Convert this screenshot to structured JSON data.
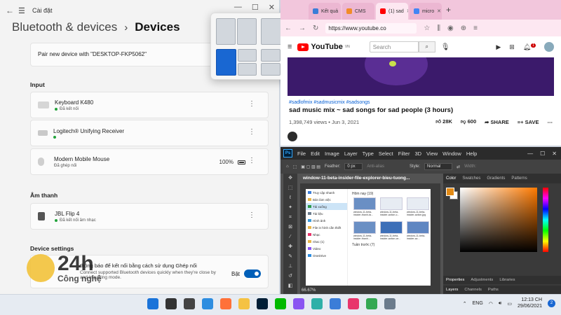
{
  "settings": {
    "app_title": "Cài đặt",
    "breadcrumb": "Bluetooth & devices",
    "page_title": "Devices",
    "pair_text": "Pair new device with \"DESKTOP-FKP5062\"",
    "input_label": "Input",
    "devices_input": [
      {
        "name": "Keyboard K480",
        "status": "Đã kết nối",
        "connected": true
      },
      {
        "name": "Logitech® Unifying Receiver",
        "status": "",
        "connected": true
      },
      {
        "name": "Modern Mobile Mouse",
        "status": "Đã ghép nối",
        "connected": false,
        "battery": "100%"
      }
    ],
    "audio_label": "Âm thanh",
    "audio_device": {
      "name": "JBL Flip 4",
      "status": "Đã kết nối âm nhạc"
    },
    "device_settings_label": "Device settings",
    "setting_text_1": "thông báo để kết nối bằng cách sử dụng Ghép nối",
    "setting_text_2": "Connect supported Bluetooth devices quickly when they're close",
    "setting_text_3": "by and in pairing mode.",
    "toggle_label": "Bật",
    "toggle_on": true
  },
  "browser": {
    "tabs": [
      {
        "label": "Kết quả",
        "color": "#3b7dd8",
        "active": false
      },
      {
        "label": "CMS",
        "color": "#f28c28",
        "active": false
      },
      {
        "label": "(1) sad",
        "color": "#ff0000",
        "active": true
      },
      {
        "label": "micro",
        "color": "#4285f4",
        "active": false
      }
    ],
    "url": "https://www.youtube.co",
    "yt_logo": "YouTube",
    "yt_region": "VN",
    "search_placeholder": "Search",
    "notification_count": "1",
    "tags": "#sadlofmix #sadmusicmix #sadsongs",
    "video_title": "sad music mix ~ sad songs for sad people (3 hours)",
    "views": "1,398,749 views • Jun 3, 2021",
    "likes": "28K",
    "dislikes": "600",
    "share": "SHARE",
    "save": "SAVE"
  },
  "photoshop": {
    "menu": [
      "File",
      "Edit",
      "Image",
      "Layer",
      "Type",
      "Select",
      "Filter",
      "3D",
      "View",
      "Window",
      "Help"
    ],
    "feather_label": "Feather:",
    "feather_value": "0 px",
    "antialias": "Anti-alias",
    "style_label": "Style:",
    "style_value": "Normal",
    "width_label": "Width:",
    "doc_tab": "window-11-beta-insider-file-explorer-bieu-tuong...",
    "zoom": "66.67%",
    "panel_tabs": [
      "Color",
      "Swatches",
      "Gradients",
      "Patterns"
    ],
    "lower_tabs_1": [
      "Properties",
      "Adjustments",
      "Libraries"
    ],
    "lower_tabs_2": [
      "Layers",
      "Channels",
      "Paths"
    ],
    "explorer": {
      "sidebar": [
        "Truy cập nhanh",
        "Bản làm việc",
        "Tải xuống",
        "Tài liệu",
        "Hình ảnh",
        "File in hình cần thiết",
        "Nhạc",
        "nhac (1)",
        "Video",
        "OneDrive"
      ],
      "group1": "Hôm nay (19)",
      "group2": "Tuần trước (7)",
      "thumbs": [
        "window-11-beta-insider-thanh-ta...",
        "window-11-beta-insider-action-c...",
        "window-11-beta-insider-action.jpg",
        "window-11-beta-insider-thanh...",
        "window-11-beta-insider-action-ce...",
        "window-11-beta-insider-ac..."
      ]
    }
  },
  "watermark": {
    "brand": "24h",
    "sub": "Công nghệ"
  },
  "taskbar": {
    "apps": [
      {
        "name": "start",
        "color": "#1a73d9"
      },
      {
        "name": "search",
        "color": "#333333"
      },
      {
        "name": "task-view",
        "color": "#444444"
      },
      {
        "name": "widgets",
        "color": "#2d8de0"
      },
      {
        "name": "firefox",
        "color": "#ff7139"
      },
      {
        "name": "file-explorer",
        "color": "#f5c243"
      },
      {
        "name": "photoshop",
        "color": "#001e36"
      },
      {
        "name": "line",
        "color": "#00b900"
      },
      {
        "name": "messenger",
        "color": "#8a55f2"
      },
      {
        "name": "edge",
        "color": "#2fb0a8"
      },
      {
        "name": "store",
        "color": "#3b7dd8"
      },
      {
        "name": "music",
        "color": "#e8356b"
      },
      {
        "name": "chrome",
        "color": "#34a853"
      },
      {
        "name": "settings",
        "color": "#6b7b8c"
      }
    ],
    "language": "ENG",
    "time": "12:13 CH",
    "date": "29/06/2021",
    "notification_count": "2"
  }
}
